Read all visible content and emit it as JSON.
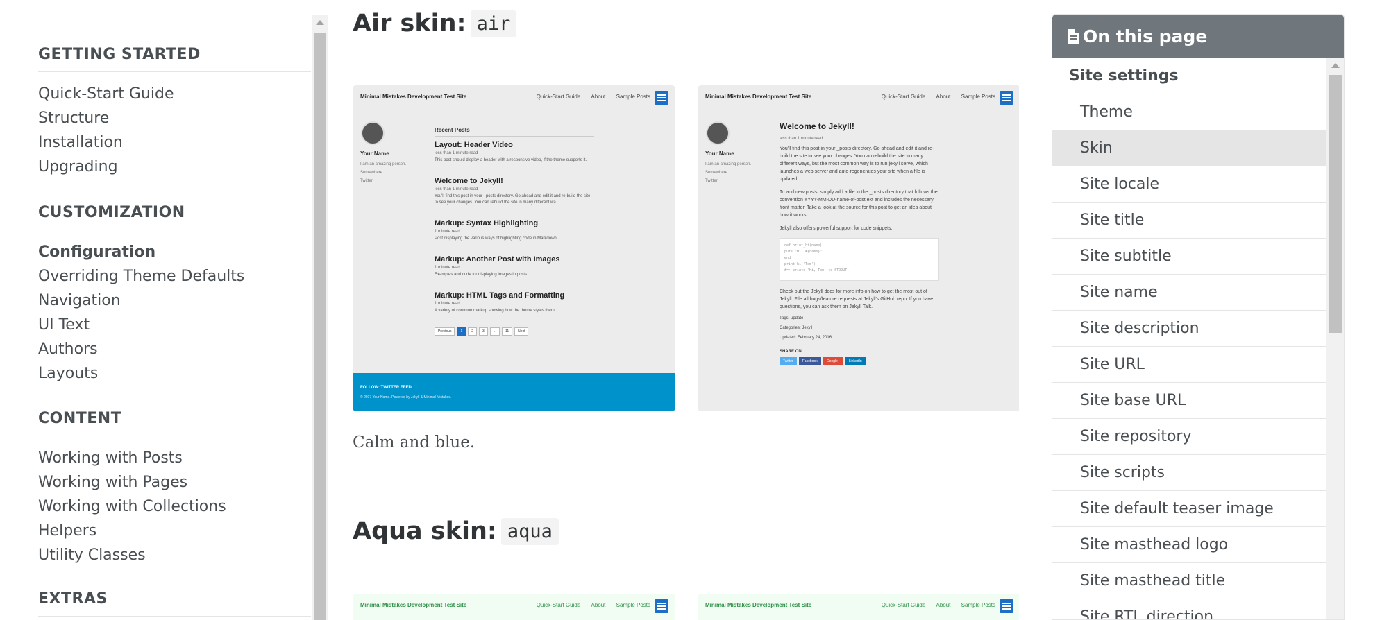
{
  "sidebar": {
    "sections": [
      {
        "title": "GETTING STARTED",
        "items": [
          "Quick-Start Guide",
          "Structure",
          "Installation",
          "Upgrading"
        ]
      },
      {
        "title": "CUSTOMIZATION",
        "items": [
          "Configuration",
          "Overriding Theme Defaults",
          "Navigation",
          "UI Text",
          "Authors",
          "Layouts"
        ]
      },
      {
        "title": "CONTENT",
        "items": [
          "Working with Posts",
          "Working with Pages",
          "Working with Collections",
          "Helpers",
          "Utility Classes"
        ]
      },
      {
        "title": "EXTRAS",
        "items": []
      }
    ],
    "active_item": "Configuration"
  },
  "main": {
    "air": {
      "heading": "Air skin:",
      "code": "air",
      "caption": "Calm and blue."
    },
    "aqua": {
      "heading": "Aqua skin:",
      "code": "aqua"
    },
    "mock": {
      "site_title": "Minimal Mistakes Development Test Site",
      "nav": [
        "Quick-Start Guide",
        "About",
        "Sample Posts"
      ],
      "author_name": "Your Name",
      "author_bio": "I am an amazing person.",
      "author_location": "Somewhere",
      "author_twitter": "Twitter",
      "recent_posts": "Recent Posts",
      "posts": [
        {
          "title": "Layout: Header Video",
          "meta": "less than 1 minute read",
          "excerpt": "This post should display a header with a responsive video, if the theme supports it."
        },
        {
          "title": "Welcome to Jekyll!",
          "meta": "less than 1 minute read",
          "excerpt": "You'll find this post in your _posts directory. Go ahead and edit it and re-build the site to see your changes. You can rebuild the site in many different wa..."
        },
        {
          "title": "Markup: Syntax Highlighting",
          "meta": "1 minute read",
          "excerpt": "Post displaying the various ways of highlighting code in Markdown."
        },
        {
          "title": "Markup: Another Post with Images",
          "meta": "1 minute read",
          "excerpt": "Examples and code for displaying images in posts."
        },
        {
          "title": "Markup: HTML Tags and Formatting",
          "meta": "1 minute read",
          "excerpt": "A variety of common markup showing how the theme styles them."
        }
      ],
      "pager": [
        "Previous",
        "1",
        "2",
        "3",
        "...",
        "11",
        "Next"
      ],
      "footer_follow": "FOLLOW:  TWITTER  FEED",
      "footer_copy": "© 2017 Your Name. Powered by Jekyll & Minimal Mistakes.",
      "article_title": "Welcome to Jekyll!",
      "article_meta": "less than 1 minute read",
      "article_p1": "You'll find this post in your _posts directory. Go ahead and edit it and re-build the site to see your changes. You can rebuild the site in many different ways, but the most common way is to run jekyll serve, which launches a web server and auto-regenerates your site when a file is updated.",
      "article_p2": "To add new posts, simply add a file in the _posts directory that follows the convention YYYY-MM-DD-name-of-post.ext and includes the necessary front matter. Take a look at the source for this post to get an idea about how it works.",
      "article_p3": "Jekyll also offers powerful support for code snippets:",
      "code_lines": [
        "def print_hi(name)",
        "  puts \"Hi, #{name}\"",
        "end",
        "print_hi('Tom')",
        "#=> prints 'Hi, Tom' to STDOUT."
      ],
      "article_p4": "Check out the Jekyll docs for more info on how to get the most out of Jekyll. File all bugs/feature requests at Jekyll's GitHub repo. If you have questions, you can ask them on Jekyll Talk.",
      "tags": "Tags:  update",
      "categories": "Categories:  Jekyll",
      "updated": "Updated: February 24, 2016",
      "share_on": "SHARE ON",
      "share_buttons": [
        {
          "label": "Twitter",
          "color": "#55acee"
        },
        {
          "label": "Facebook",
          "color": "#3b5998"
        },
        {
          "label": "Google+",
          "color": "#dd4b39"
        },
        {
          "label": "LinkedIn",
          "color": "#007bb6"
        }
      ]
    }
  },
  "toc": {
    "title": "On this page",
    "section": "Site settings",
    "items": [
      "Theme",
      "Skin",
      "Site locale",
      "Site title",
      "Site subtitle",
      "Site name",
      "Site description",
      "Site URL",
      "Site base URL",
      "Site repository",
      "Site scripts",
      "Site default teaser image",
      "Site masthead logo",
      "Site masthead title",
      "Site RTL direction"
    ],
    "active": "Skin"
  },
  "colors": {
    "toc_header": "#6f777d",
    "air_footer": "#0092ca",
    "aqua_masthead": "#f1fcf3",
    "menu_button": "#1d6fc6"
  }
}
